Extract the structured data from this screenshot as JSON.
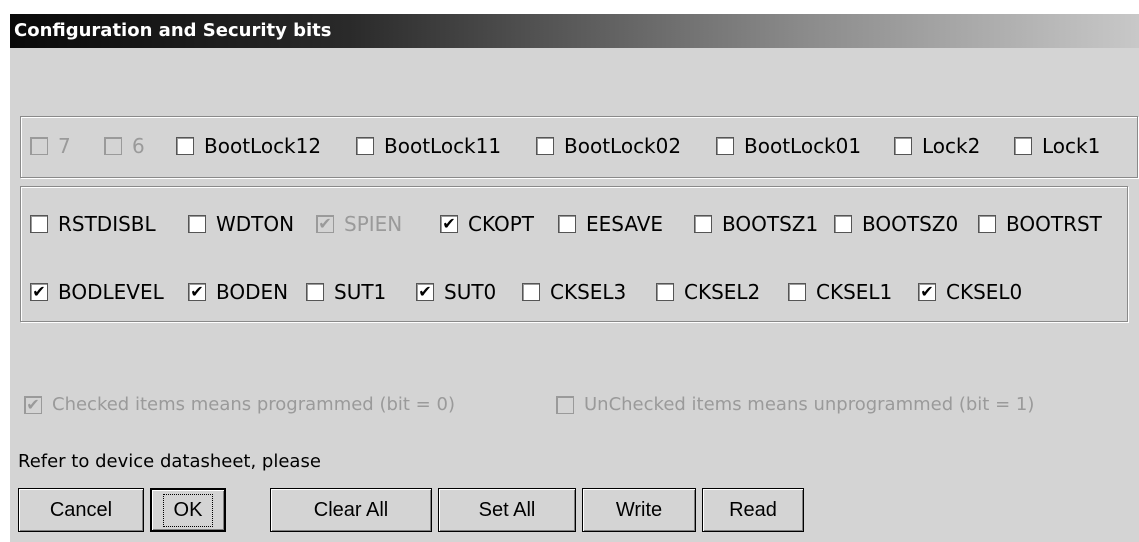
{
  "window": {
    "title": "Configuration and Security bits"
  },
  "lock_bits": [
    {
      "label": "7",
      "checked": false,
      "disabled": true
    },
    {
      "label": "6",
      "checked": false,
      "disabled": true
    },
    {
      "label": "BootLock12",
      "checked": false,
      "disabled": false
    },
    {
      "label": "BootLock11",
      "checked": false,
      "disabled": false
    },
    {
      "label": "BootLock02",
      "checked": false,
      "disabled": false
    },
    {
      "label": "BootLock01",
      "checked": false,
      "disabled": false
    },
    {
      "label": "Lock2",
      "checked": false,
      "disabled": false
    },
    {
      "label": "Lock1",
      "checked": false,
      "disabled": false
    }
  ],
  "fuse_high": [
    {
      "label": "RSTDISBL",
      "checked": false,
      "disabled": false
    },
    {
      "label": "WDTON",
      "checked": false,
      "disabled": false
    },
    {
      "label": "SPIEN",
      "checked": true,
      "disabled": true
    },
    {
      "label": "CKOPT",
      "checked": true,
      "disabled": false
    },
    {
      "label": "EESAVE",
      "checked": false,
      "disabled": false
    },
    {
      "label": "BOOTSZ1",
      "checked": false,
      "disabled": false
    },
    {
      "label": "BOOTSZ0",
      "checked": false,
      "disabled": false
    },
    {
      "label": "BOOTRST",
      "checked": false,
      "disabled": false
    }
  ],
  "fuse_low": [
    {
      "label": "BODLEVEL",
      "checked": true,
      "disabled": false
    },
    {
      "label": "BODEN",
      "checked": true,
      "disabled": false
    },
    {
      "label": "SUT1",
      "checked": false,
      "disabled": false
    },
    {
      "label": "SUT0",
      "checked": true,
      "disabled": false
    },
    {
      "label": "CKSEL3",
      "checked": false,
      "disabled": false
    },
    {
      "label": "CKSEL2",
      "checked": false,
      "disabled": false
    },
    {
      "label": "CKSEL1",
      "checked": false,
      "disabled": false
    },
    {
      "label": "CKSEL0",
      "checked": true,
      "disabled": false
    }
  ],
  "legend": {
    "checked": {
      "label": "Checked items means programmed (bit = 0)",
      "checked": true,
      "disabled": true
    },
    "unchecked": {
      "label": "UnChecked items means unprogrammed (bit = 1)",
      "checked": false,
      "disabled": true
    }
  },
  "hint": "Refer to device datasheet, please",
  "buttons": {
    "cancel": "Cancel",
    "ok": "OK",
    "clear_all": "Clear All",
    "set_all": "Set All",
    "write": "Write",
    "read": "Read"
  },
  "check_glyph": "✔"
}
